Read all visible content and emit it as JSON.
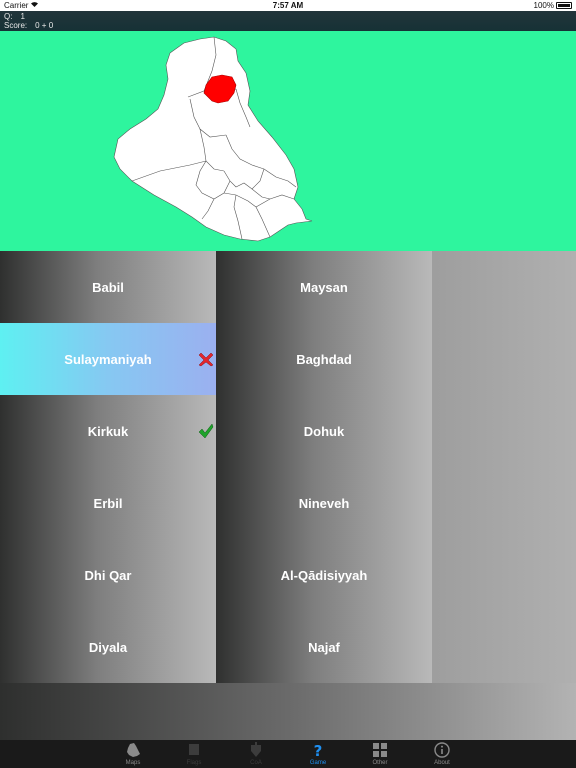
{
  "status_bar": {
    "carrier": "Carrier",
    "time": "7:57 AM",
    "battery": "100%"
  },
  "game_info": {
    "question_label": "Q:",
    "question_number": "1",
    "score_label": "Score:",
    "score_value": "0 + 0"
  },
  "map": {
    "background_color": "#2ef59e",
    "highlight_color": "#ff0000"
  },
  "choices": {
    "left": [
      {
        "label": "Babil",
        "state": "none"
      },
      {
        "label": "Sulaymaniyah",
        "state": "wrong"
      },
      {
        "label": "Kirkuk",
        "state": "correct"
      },
      {
        "label": "Erbil",
        "state": "none"
      },
      {
        "label": "Dhi Qar",
        "state": "none"
      },
      {
        "label": "Diyala",
        "state": "none"
      }
    ],
    "right": [
      {
        "label": "Maysan",
        "state": "none"
      },
      {
        "label": "Baghdad",
        "state": "none"
      },
      {
        "label": "Dohuk",
        "state": "none"
      },
      {
        "label": "Nineveh",
        "state": "none"
      },
      {
        "label": "Al-Qādisiyyah",
        "state": "none"
      },
      {
        "label": "Najaf",
        "state": "none"
      }
    ]
  },
  "tab_bar": {
    "items": [
      {
        "label": "Maps",
        "icon": "map-icon",
        "state": "normal"
      },
      {
        "label": "Flags",
        "icon": "flag-icon",
        "state": "disabled"
      },
      {
        "label": "CoA",
        "icon": "coat-of-arms-icon",
        "state": "disabled"
      },
      {
        "label": "Game",
        "icon": "question-icon",
        "state": "active"
      },
      {
        "label": "Other",
        "icon": "grid-icon",
        "state": "normal"
      },
      {
        "label": "About",
        "icon": "info-icon",
        "state": "normal"
      }
    ]
  }
}
